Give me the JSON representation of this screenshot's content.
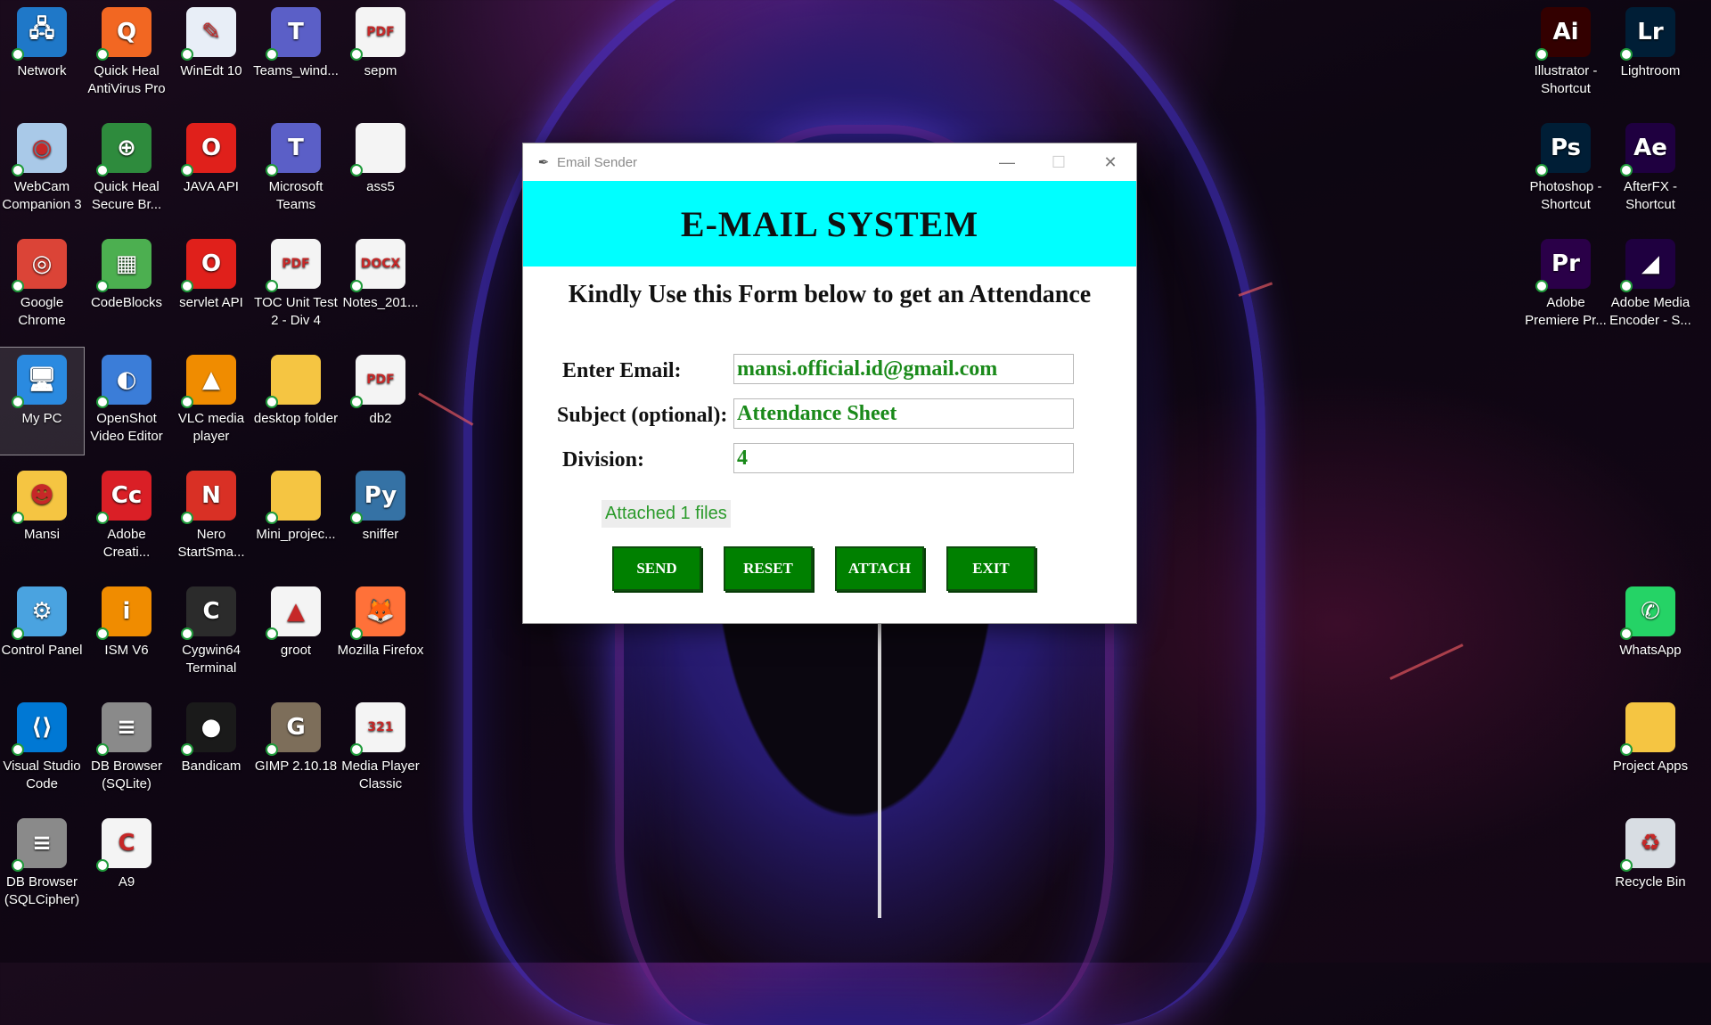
{
  "window": {
    "title": "Email Sender",
    "banner": "E-MAIL SYSTEM",
    "subtitle": "Kindly Use this Form below to get an Attendance",
    "fields": {
      "email": {
        "label": "Enter Email:",
        "value": "mansi.official.id@gmail.com"
      },
      "subject": {
        "label": "Subject (optional):",
        "value": "Attendance Sheet"
      },
      "division": {
        "label": "Division:",
        "value": "4"
      }
    },
    "attach_status": "Attached 1 files",
    "buttons": {
      "send": "SEND",
      "reset": "RESET",
      "attach": "ATTACH",
      "exit": "EXIT"
    },
    "controls": {
      "minimize": "—",
      "maximize": "☐",
      "close": "✕"
    }
  },
  "desktop_icons": [
    {
      "label": "Network",
      "icon": "network-icon",
      "color": "#1f78c8",
      "glyph": "🖧"
    },
    {
      "label": "Quick Heal AntiVirus Pro",
      "icon": "quickheal-icon",
      "color": "#f26722",
      "glyph": "Q"
    },
    {
      "label": "WinEdt 10",
      "icon": "winedt-icon",
      "color": "#e8eef7",
      "glyph": "✎"
    },
    {
      "label": "Teams_wind...",
      "icon": "teams-icon",
      "color": "#5b5fc7",
      "glyph": "T"
    },
    {
      "label": "sepm",
      "icon": "pdf-icon",
      "color": "#f4f4f4",
      "glyph": "PDF"
    },
    {
      "label": "WebCam Companion 3",
      "icon": "webcam-icon",
      "color": "#a9c9e8",
      "glyph": "◉"
    },
    {
      "label": "Quick Heal Secure Br...",
      "icon": "quickheal-browser-icon",
      "color": "#2e8b3d",
      "glyph": "⊕"
    },
    {
      "label": "JAVA API",
      "icon": "oracle-icon",
      "color": "#e0201b",
      "glyph": "O"
    },
    {
      "label": "Microsoft Teams",
      "icon": "teams-icon",
      "color": "#5b5fc7",
      "glyph": "T"
    },
    {
      "label": "ass5",
      "icon": "file-icon",
      "color": "#f4f4f4",
      "glyph": ""
    },
    {
      "label": "Google Chrome",
      "icon": "chrome-icon",
      "color": "#db4437",
      "glyph": "◎"
    },
    {
      "label": "CodeBlocks",
      "icon": "codeblocks-icon",
      "color": "#4caf50",
      "glyph": "▦"
    },
    {
      "label": "servlet API",
      "icon": "oracle-icon",
      "color": "#e0201b",
      "glyph": "O"
    },
    {
      "label": "TOC Unit Test 2 - Div 4",
      "icon": "pdf-icon",
      "color": "#f4f4f4",
      "glyph": "PDF"
    },
    {
      "label": "Notes_201...",
      "icon": "docx-icon",
      "color": "#f4f4f4",
      "glyph": "DOCX"
    },
    {
      "label": "My PC",
      "icon": "computer-icon",
      "color": "#2a8ae0",
      "glyph": "🖥"
    },
    {
      "label": "OpenShot Video Editor",
      "icon": "openshot-icon",
      "color": "#3b7dd8",
      "glyph": "◐"
    },
    {
      "label": "VLC media player",
      "icon": "vlc-icon",
      "color": "#f08c00",
      "glyph": "▲"
    },
    {
      "label": "desktop folder",
      "icon": "folder-icon",
      "color": "#f5c542",
      "glyph": ""
    },
    {
      "label": "db2",
      "icon": "pdf-icon",
      "color": "#f4f4f4",
      "glyph": "PDF"
    },
    {
      "label": "Mansi",
      "icon": "user-folder-icon",
      "color": "#f5c542",
      "glyph": "☻"
    },
    {
      "label": "Adobe Creati...",
      "icon": "adobe-cc-icon",
      "color": "#da1f26",
      "glyph": "Cc"
    },
    {
      "label": "Nero StartSma...",
      "icon": "nero-icon",
      "color": "#d93025",
      "glyph": "N"
    },
    {
      "label": "Mini_projec...",
      "icon": "folder-icon",
      "color": "#f5c542",
      "glyph": ""
    },
    {
      "label": "sniffer",
      "icon": "python-icon",
      "color": "#3572a5",
      "glyph": "Py"
    },
    {
      "label": "Control Panel",
      "icon": "control-panel-icon",
      "color": "#4aa3e0",
      "glyph": "⚙"
    },
    {
      "label": "ISM V6",
      "icon": "ism-icon",
      "color": "#f08c00",
      "glyph": "i"
    },
    {
      "label": "Cygwin64 Terminal",
      "icon": "terminal-icon",
      "color": "#2b2b2b",
      "glyph": "C"
    },
    {
      "label": "groot",
      "icon": "image-file-icon",
      "color": "#f4f4f4",
      "glyph": "▲"
    },
    {
      "label": "Mozilla Firefox",
      "icon": "firefox-icon",
      "color": "#ff7139",
      "glyph": "🦊"
    },
    {
      "label": "Visual Studio Code",
      "icon": "vscode-icon",
      "color": "#0078d4",
      "glyph": "⟨⟩"
    },
    {
      "label": "DB Browser (SQLite)",
      "icon": "database-icon",
      "color": "#8a8a8a",
      "glyph": "≡"
    },
    {
      "label": "Bandicam",
      "icon": "bandicam-icon",
      "color": "#1a1a1a",
      "glyph": "●"
    },
    {
      "label": "GIMP 2.10.18",
      "icon": "gimp-icon",
      "color": "#7d6e5a",
      "glyph": "G"
    },
    {
      "label": "Media Player Classic",
      "icon": "mpc-icon",
      "color": "#f4f4f4",
      "glyph": "321"
    },
    {
      "label": "DB Browser (SQLCipher)",
      "icon": "database-icon",
      "color": "#8a8a8a",
      "glyph": "≡"
    },
    {
      "label": "A9",
      "icon": "c-file-icon",
      "color": "#f4f4f4",
      "glyph": "C"
    },
    {
      "label": "Illustrator - Shortcut",
      "icon": "illustrator-icon",
      "color": "#330000",
      "glyph": "Ai"
    },
    {
      "label": "Lightroom",
      "icon": "lightroom-icon",
      "color": "#001e36",
      "glyph": "Lr"
    },
    {
      "label": "Photoshop - Shortcut",
      "icon": "photoshop-icon",
      "color": "#001e36",
      "glyph": "Ps"
    },
    {
      "label": "AfterFX - Shortcut",
      "icon": "aftereffects-icon",
      "color": "#1f0040",
      "glyph": "Ae"
    },
    {
      "label": "Adobe Premiere Pr...",
      "icon": "premiere-icon",
      "color": "#2a0048",
      "glyph": "Pr"
    },
    {
      "label": "Adobe Media Encoder - S...",
      "icon": "media-encoder-icon",
      "color": "#1f0040",
      "glyph": "◢"
    },
    {
      "label": "WhatsApp",
      "icon": "whatsapp-icon",
      "color": "#25d366",
      "glyph": "✆"
    },
    {
      "label": "Project Apps",
      "icon": "folder-icon",
      "color": "#f5c542",
      "glyph": ""
    },
    {
      "label": "Recycle Bin",
      "icon": "recycle-bin-icon",
      "color": "#d8dde3",
      "glyph": "♻"
    }
  ]
}
